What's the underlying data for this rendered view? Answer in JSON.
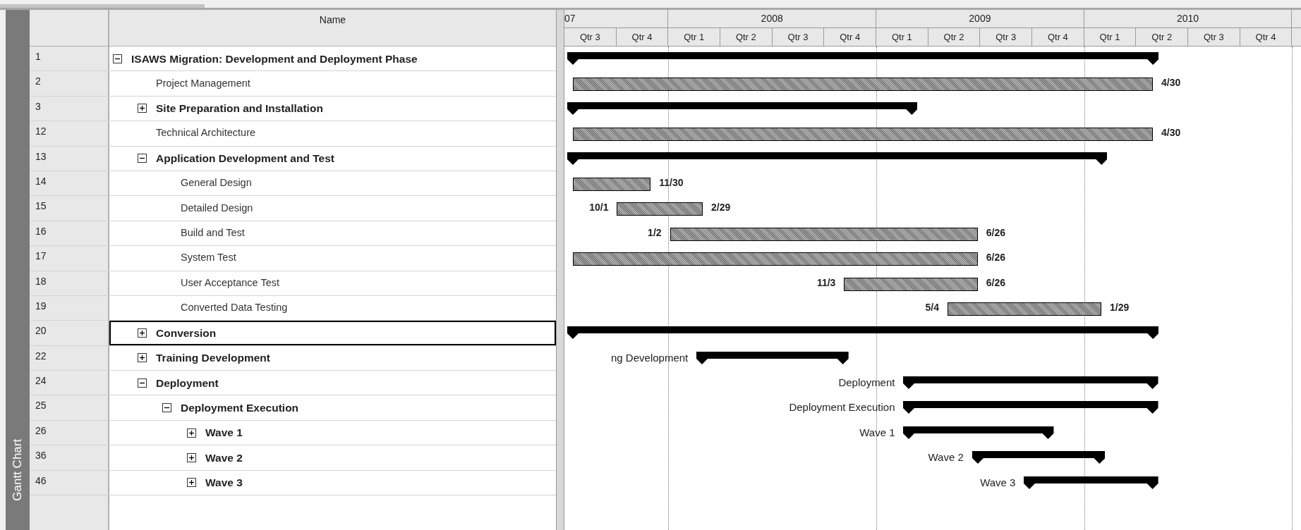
{
  "view_bar": {
    "label": "Gantt Chart"
  },
  "table": {
    "columns": [
      {
        "label": "Name"
      }
    ]
  },
  "timescale": {
    "years": [
      {
        "label": "07",
        "quarters": [
          "Qtr 3",
          "Qtr 4"
        ]
      },
      {
        "label": "2008",
        "quarters": [
          "Qtr 1",
          "Qtr 2",
          "Qtr 3",
          "Qtr 4"
        ]
      },
      {
        "label": "2009",
        "quarters": [
          "Qtr 1",
          "Qtr 2",
          "Qtr 3",
          "Qtr 4"
        ]
      },
      {
        "label": "2010",
        "quarters": [
          "Qtr 1",
          "Qtr 2",
          "Qtr 3",
          "Qtr 4"
        ]
      }
    ]
  },
  "tasks": [
    {
      "id": "1",
      "name": "ISAWS Migration: Development and Deployment Phase",
      "kind": "summary",
      "expanded": true,
      "selected": false,
      "children": [
        {
          "id": "2",
          "name": "Project Management",
          "kind": "task",
          "selected": false,
          "finish_label": "4/30"
        },
        {
          "id": "3",
          "name": "Site Preparation and Installation",
          "kind": "summary",
          "expanded": false,
          "selected": false
        },
        {
          "id": "12",
          "name": "Technical Architecture",
          "kind": "task",
          "selected": false,
          "finish_label": "4/30"
        },
        {
          "id": "13",
          "name": "Application Development and Test",
          "kind": "summary",
          "expanded": true,
          "selected": false,
          "children": [
            {
              "id": "14",
              "name": "General Design",
              "kind": "task",
              "selected": false,
              "finish_label": "11/30"
            },
            {
              "id": "15",
              "name": "Detailed Design",
              "kind": "task",
              "selected": false,
              "start_label": "10/1",
              "finish_label": "2/29"
            },
            {
              "id": "16",
              "name": "Build and Test",
              "kind": "task",
              "selected": false,
              "start_label": "1/2",
              "finish_label": "6/26"
            },
            {
              "id": "17",
              "name": "System Test",
              "kind": "task",
              "selected": false,
              "finish_label": "6/26"
            },
            {
              "id": "18",
              "name": "User Acceptance Test",
              "kind": "task",
              "selected": false,
              "start_label": "11/3",
              "finish_label": "6/26"
            },
            {
              "id": "19",
              "name": "Converted Data Testing",
              "kind": "task",
              "selected": false,
              "start_label": "5/4",
              "finish_label": "1/29"
            }
          ]
        },
        {
          "id": "20",
          "name": "Conversion",
          "kind": "summary",
          "expanded": false,
          "selected": true
        },
        {
          "id": "22",
          "name": "Training Development",
          "kind": "summary",
          "expanded": false,
          "selected": false,
          "bar_label": "ng Development"
        },
        {
          "id": "24",
          "name": "Deployment",
          "kind": "summary",
          "expanded": true,
          "selected": false,
          "bar_label": "Deployment",
          "children": [
            {
              "id": "25",
              "name": "Deployment Execution",
              "kind": "summary",
              "expanded": true,
              "selected": false,
              "bar_label": "Deployment Execution",
              "children": [
                {
                  "id": "26",
                  "name": "Wave 1",
                  "kind": "summary",
                  "expanded": false,
                  "selected": false,
                  "bar_label": "Wave 1"
                },
                {
                  "id": "36",
                  "name": "Wave 2",
                  "kind": "summary",
                  "expanded": false,
                  "selected": false,
                  "bar_label": "Wave 2"
                },
                {
                  "id": "46",
                  "name": "Wave 3",
                  "kind": "summary",
                  "expanded": false,
                  "selected": false,
                  "bar_label": "Wave 3"
                }
              ]
            }
          ]
        }
      ]
    }
  ]
}
